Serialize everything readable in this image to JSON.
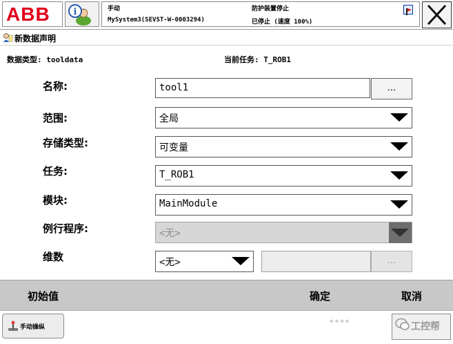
{
  "topbar": {
    "logo": "ABB",
    "mode": "手动",
    "system": "MySystem3(SEVST-W-0003294)",
    "guard_status": "防护装置停止",
    "run_state": "已停止 (速度 100%)"
  },
  "title": "新数据声明",
  "info": {
    "data_type": "数据类型: tooldata",
    "current_task": "当前任务:  T_ROB1"
  },
  "form": {
    "name_label": "名称:",
    "name_value": "tool1",
    "ellipsis": "...",
    "scope_label": "范围:",
    "scope_value": "全局",
    "storage_label": "存储类型:",
    "storage_value": "可变量",
    "task_label": "任务:",
    "task_value": "T_ROB1",
    "module_label": "模块:",
    "module_value": "MainModule",
    "routine_label": "例行程序:",
    "routine_value": "<无>",
    "dim_label": "维数",
    "dim_value": "<无>",
    "dim_ellipsis": "..."
  },
  "commands": {
    "initial_value": "初始值",
    "ok": "确定",
    "cancel": "取消"
  },
  "taskbar": {
    "jog_label": "手动操纵",
    "watermark": "工控帮"
  },
  "colors": {
    "brand": "#e2001a",
    "command_bar": "#c8c8c8",
    "disabled_field": "#d6d6d6"
  }
}
